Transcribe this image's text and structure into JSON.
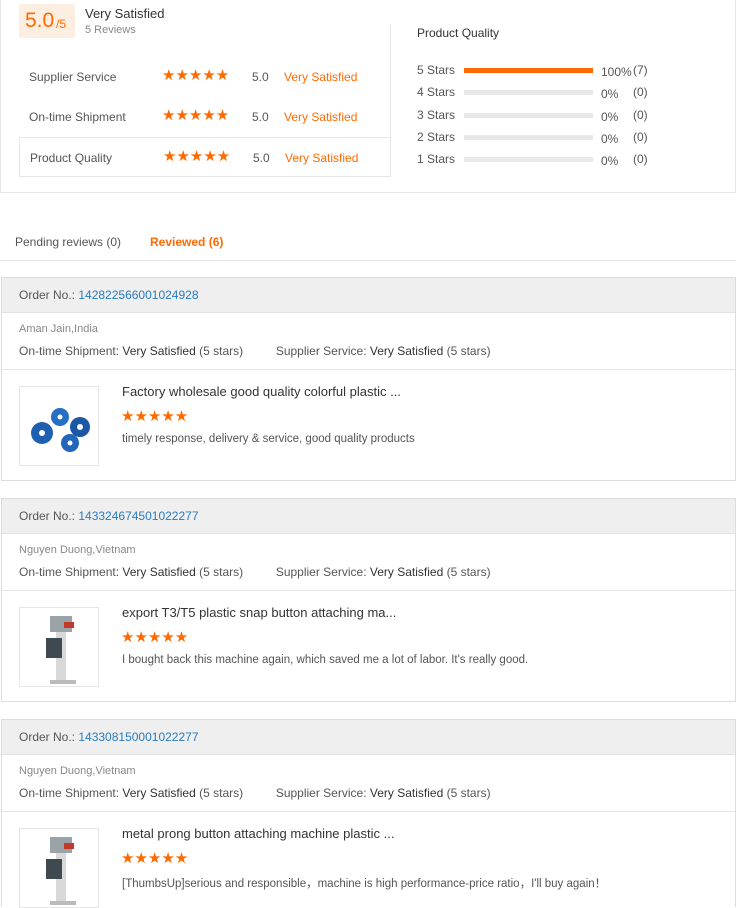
{
  "summary": {
    "score": "5.0",
    "score_suffix": "/5",
    "rating_text": "Very Satisfied",
    "review_count": "5 Reviews",
    "criteria": [
      {
        "label": "Supplier Service",
        "stars": "★★★★★",
        "value": "5.0",
        "satisfaction": "Very Satisfied"
      },
      {
        "label": "On-time Shipment",
        "stars": "★★★★★",
        "value": "5.0",
        "satisfaction": "Very Satisfied"
      },
      {
        "label": "Product Quality",
        "stars": "★★★★★",
        "value": "5.0",
        "satisfaction": "Very Satisfied"
      }
    ],
    "distribution_title": "Product Quality",
    "distribution": [
      {
        "label": "5 Stars",
        "percent": "100%",
        "count": "(7)",
        "fill": 1.0
      },
      {
        "label": "4 Stars",
        "percent": "0%",
        "count": "(0)",
        "fill": 0
      },
      {
        "label": "3 Stars",
        "percent": "0%",
        "count": "(0)",
        "fill": 0
      },
      {
        "label": "2 Stars",
        "percent": "0%",
        "count": "(0)",
        "fill": 0
      },
      {
        "label": "1 Stars",
        "percent": "0%",
        "count": "(0)",
        "fill": 0
      }
    ]
  },
  "tabs": {
    "pending": "Pending reviews (0)",
    "reviewed": "Reviewed (6)"
  },
  "labels": {
    "order_no": "Order No.:",
    "ontime": "On-time Shipment:",
    "supplier": "Supplier Service:"
  },
  "reviews": [
    {
      "order_no": "142822566001024928",
      "reviewer": "Aman Jain,India",
      "ontime_value": "Very Satisfied",
      "ontime_stars": "(5 stars)",
      "supplier_value": "Very Satisfied",
      "supplier_stars": "(5 stars)",
      "product_title": "Factory wholesale good quality colorful plastic ...",
      "stars": "★★★★★",
      "comment": "timely response, delivery & service, good quality products"
    },
    {
      "order_no": "143324674501022277",
      "reviewer": "Nguyen Duong,Vietnam",
      "ontime_value": "Very Satisfied",
      "ontime_stars": "(5 stars)",
      "supplier_value": "Very Satisfied",
      "supplier_stars": "(5 stars)",
      "product_title": "export T3/T5 plastic snap button attaching ma...",
      "stars": "★★★★★",
      "comment": "I bought back this machine again, which saved me a lot of labor. It's really good."
    },
    {
      "order_no": "143308150001022277",
      "reviewer": "Nguyen Duong,Vietnam",
      "ontime_value": "Very Satisfied",
      "ontime_stars": "(5 stars)",
      "supplier_value": "Very Satisfied",
      "supplier_stars": "(5 stars)",
      "product_title": "metal prong button attaching machine plastic ...",
      "stars": "★★★★★",
      "comment": "[ThumbsUp]serious and responsible，machine is high performance-price ratio，I'll buy again！"
    }
  ],
  "colors": {
    "accent": "#ff6a00",
    "link": "#2a7ac0"
  }
}
